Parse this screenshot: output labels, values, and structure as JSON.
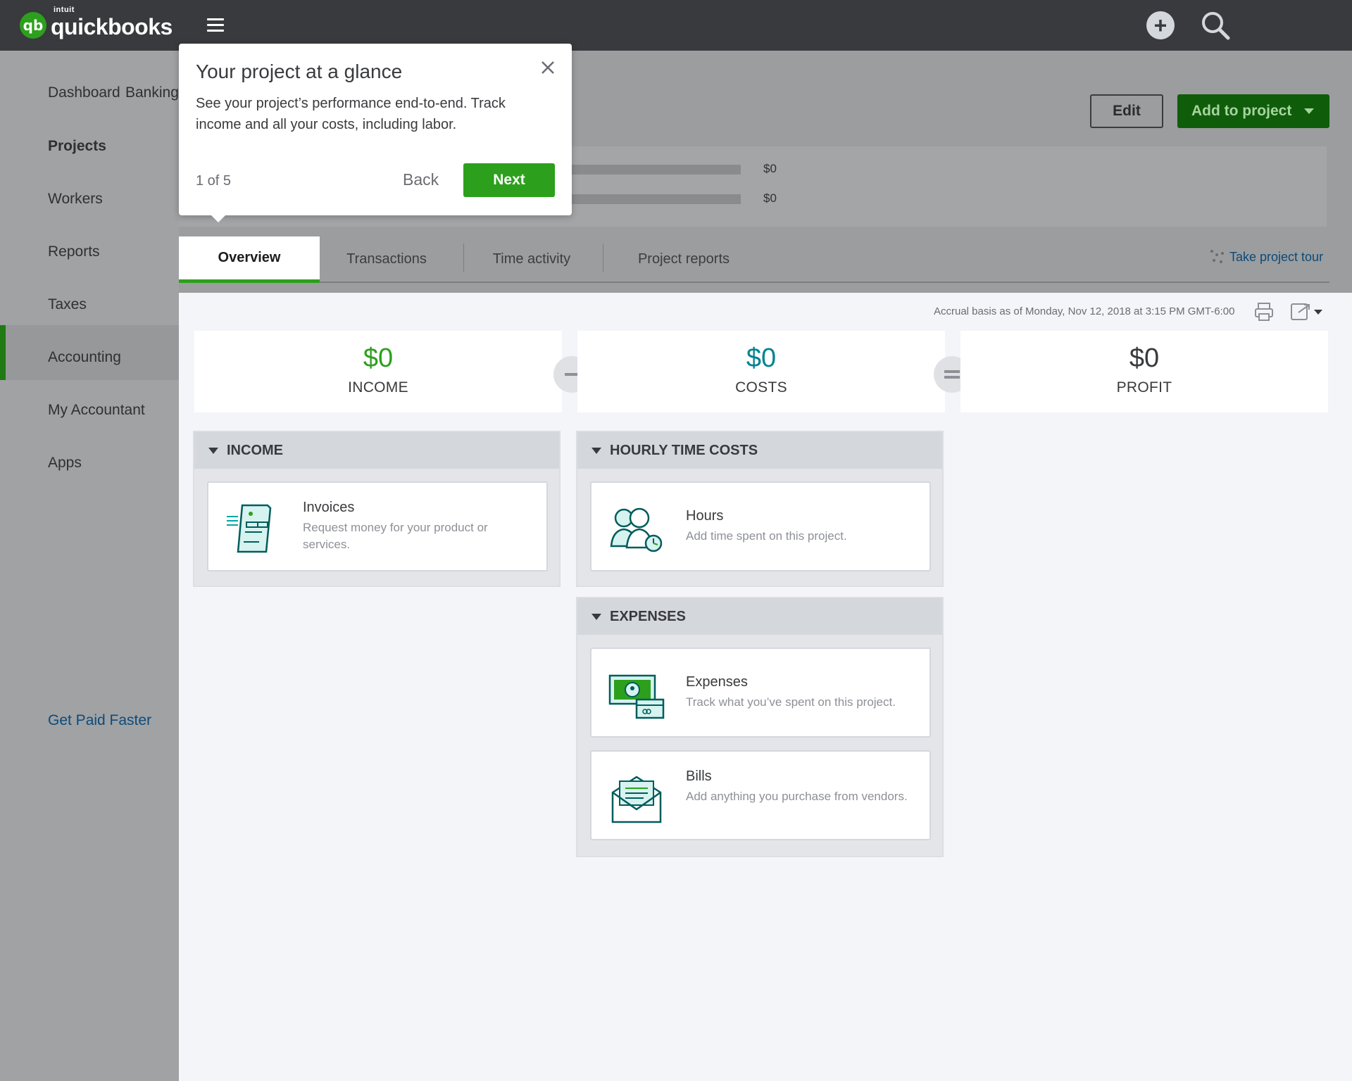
{
  "brand": {
    "logo_mark": "qb",
    "logo_top": "intuit",
    "logo_name": "quickbooks",
    "accent": "#2ca01c"
  },
  "topbar": {
    "plus_icon": "plus-icon",
    "search_icon": "search-icon"
  },
  "sidebar": {
    "items": [
      {
        "label": "Dashboard"
      },
      {
        "label": "Banking"
      },
      {
        "label": "Projects"
      },
      {
        "label": "Workers"
      },
      {
        "label": "Reports"
      },
      {
        "label": "Taxes"
      },
      {
        "label": "Accounting"
      },
      {
        "label": "My Accountant"
      },
      {
        "label": "Apps"
      }
    ],
    "get_paid": "Get Paid Faster"
  },
  "header": {
    "edit_label": "Edit",
    "add_label": "Add to project"
  },
  "summary": {
    "bar1_value": "$0",
    "bar2_value": "$0"
  },
  "tabs": [
    {
      "label": "Overview"
    },
    {
      "label": "Transactions"
    },
    {
      "label": "Time activity"
    },
    {
      "label": "Project reports"
    }
  ],
  "tour_link": "Take project tour",
  "asof": "Accrual basis as of Monday, Nov 12, 2018 at 3:15 PM GMT-6:00",
  "kpis": {
    "income": {
      "value": "$0",
      "label": "INCOME",
      "color": "#2ca01c"
    },
    "costs": {
      "value": "$0",
      "label": "COSTS",
      "color": "#00838f"
    },
    "profit": {
      "value": "$0",
      "label": "PROFIT",
      "color": "#393a3d"
    }
  },
  "sections": {
    "income": {
      "title": "INCOME",
      "cards": [
        {
          "title": "Invoices",
          "desc": "Request money for your product or services."
        }
      ]
    },
    "hourly": {
      "title": "HOURLY TIME COSTS",
      "cards": [
        {
          "title": "Hours",
          "desc": "Add time spent on this project."
        }
      ]
    },
    "expenses": {
      "title": "EXPENSES",
      "cards": [
        {
          "title": "Expenses",
          "desc": "Track what you’ve spent on this project."
        },
        {
          "title": "Bills",
          "desc": "Add anything you purchase from vendors."
        }
      ]
    }
  },
  "popover": {
    "title": "Your project at a glance",
    "body": "See your project’s performance end-to-end. Track income and all your costs, including labor.",
    "step": "1 of 5",
    "back": "Back",
    "next": "Next"
  }
}
